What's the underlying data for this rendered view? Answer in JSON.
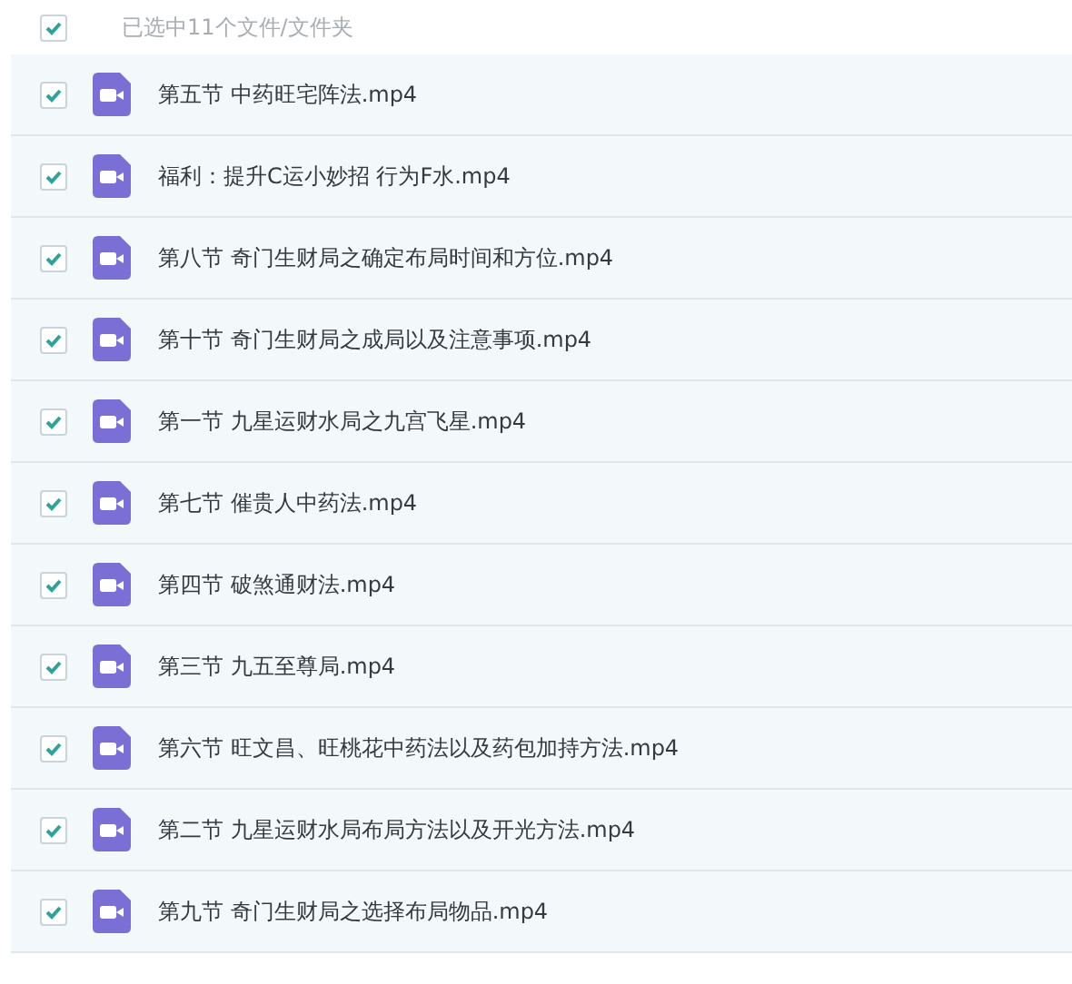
{
  "header": {
    "checked": true,
    "summary": "已选中11个文件/文件夹"
  },
  "files": [
    {
      "name": "第五节 中药旺宅阵法.mp4",
      "checked": true
    },
    {
      "name": "福利：提升C运小妙招 行为F水.mp4",
      "checked": true
    },
    {
      "name": "第八节 奇门生财局之确定布局时间和方位.mp4",
      "checked": true
    },
    {
      "name": "第十节 奇门生财局之成局以及注意事项.mp4",
      "checked": true
    },
    {
      "name": "第一节 九星运财水局之九宫飞星.mp4",
      "checked": true
    },
    {
      "name": "第七节 催贵人中药法.mp4",
      "checked": true
    },
    {
      "name": "第四节 破煞通财法.mp4",
      "checked": true
    },
    {
      "name": "第三节 九五至尊局.mp4",
      "checked": true
    },
    {
      "name": "第六节 旺文昌、旺桃花中药法以及药包加持方法.mp4",
      "checked": true
    },
    {
      "name": "第二节 九星运财水局布局方法以及开光方法.mp4",
      "checked": true
    },
    {
      "name": "第九节 奇门生财局之选择布局物品.mp4",
      "checked": true
    }
  ]
}
